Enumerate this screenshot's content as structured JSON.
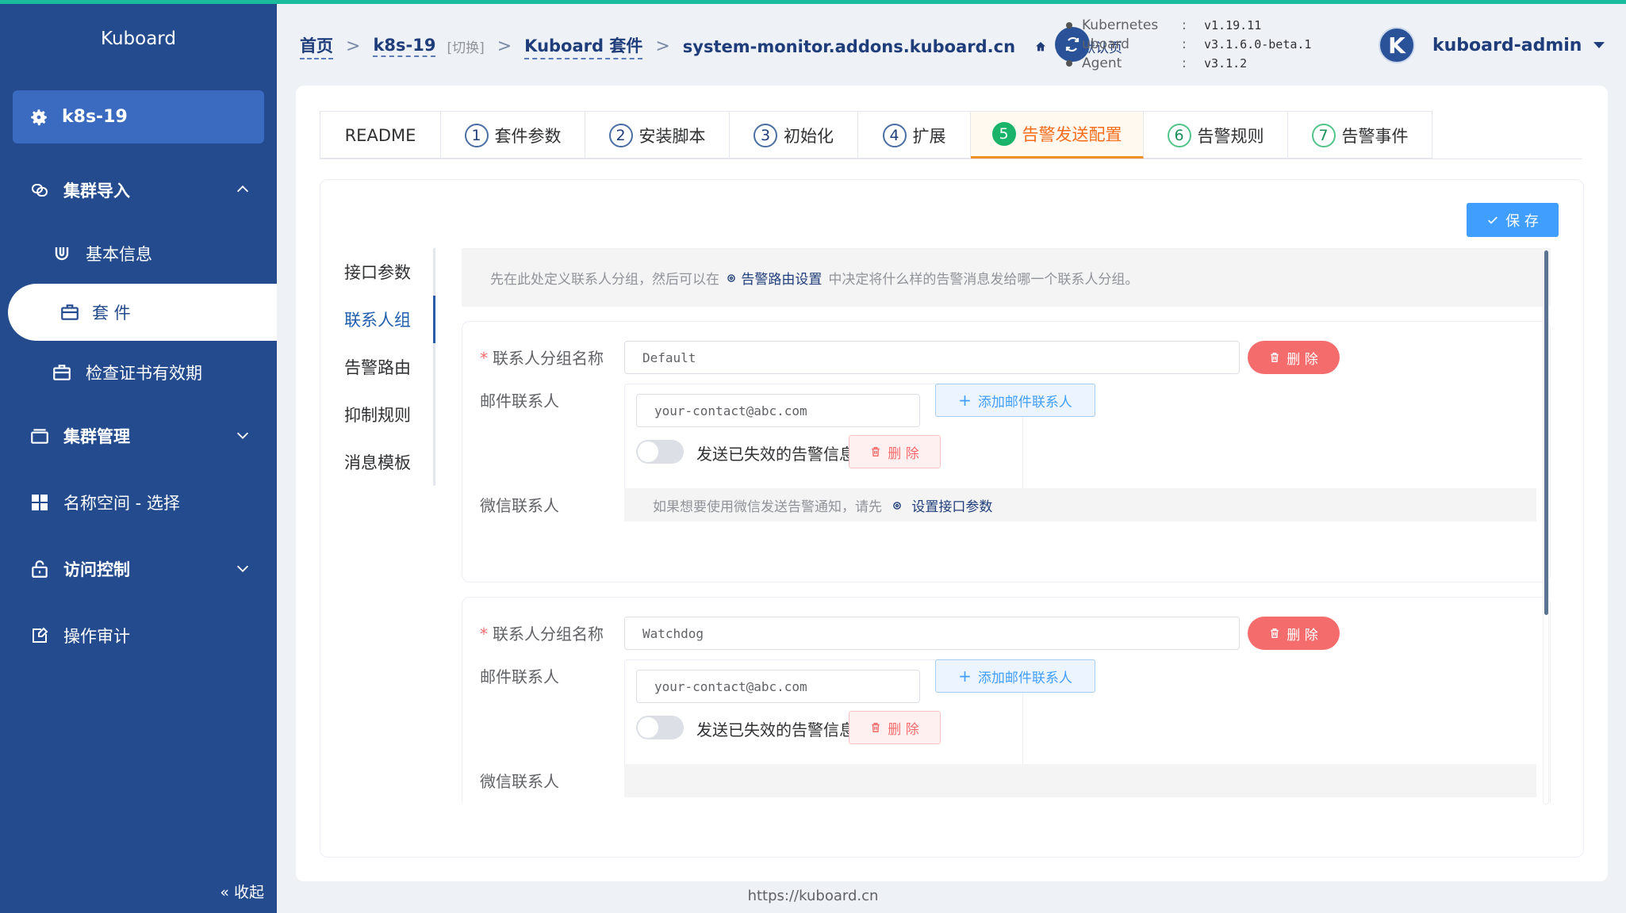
{
  "sidebar": {
    "logo": "Kuboard",
    "cluster": "k8s-19",
    "items": [
      {
        "label": "集群导入"
      },
      {
        "label": "基本信息"
      },
      {
        "label": "套 件"
      },
      {
        "label": "检查证书有效期"
      },
      {
        "label": "集群管理"
      },
      {
        "label": "名称空间 - 选择"
      },
      {
        "label": "访问控制"
      },
      {
        "label": "操作审计"
      }
    ],
    "collapse": "« 收起"
  },
  "breadcrumb": {
    "home": "首页",
    "cluster": "k8s-19",
    "switch": "[切换]",
    "kit": "Kuboard 套件",
    "current": "system-monitor.addons.kuboard.cn",
    "set_default": "设为默认页"
  },
  "versions": [
    {
      "key": "Kubernetes",
      "value": "v1.19.11"
    },
    {
      "key": "uboard",
      "value": "v3.1.6.0-beta.1"
    },
    {
      "key": "Agent",
      "value": "v3.1.2"
    }
  ],
  "user": {
    "initial": "K",
    "name": "kuboard-admin"
  },
  "tabs": [
    {
      "num": "",
      "label": "README"
    },
    {
      "num": "1",
      "label": "套件参数"
    },
    {
      "num": "2",
      "label": "安装脚本"
    },
    {
      "num": "3",
      "label": "初始化"
    },
    {
      "num": "4",
      "label": "扩展"
    },
    {
      "num": "5",
      "label": "告警发送配置"
    },
    {
      "num": "6",
      "label": "告警规则"
    },
    {
      "num": "7",
      "label": "告警事件"
    }
  ],
  "save_label": "保 存",
  "subnav": [
    "接口参数",
    "联系人组",
    "告警路由",
    "抑制规则",
    "消息模板"
  ],
  "hint": {
    "before": "先在此处定义联系人分组，然后可以在",
    "link": "告警路由设置",
    "after": "中决定将什么样的告警消息发给哪一个联系人分组。"
  },
  "labels": {
    "group_name": "联系人分组名称",
    "mail": "邮件联系人",
    "wechat": "微信联系人",
    "delete": "删 除",
    "add_mail": "添加邮件联系人",
    "send_expired": "发送已失效的告警信息",
    "wechat_hint": "如果想要使用微信发送告警通知，请先",
    "wechat_link": "设置接口参数"
  },
  "groups": [
    {
      "name": "Default",
      "email": "your-contact@abc.com"
    },
    {
      "name": "Watchdog",
      "email": "your-contact@abc.com"
    }
  ],
  "footer": "https://kuboard.cn"
}
